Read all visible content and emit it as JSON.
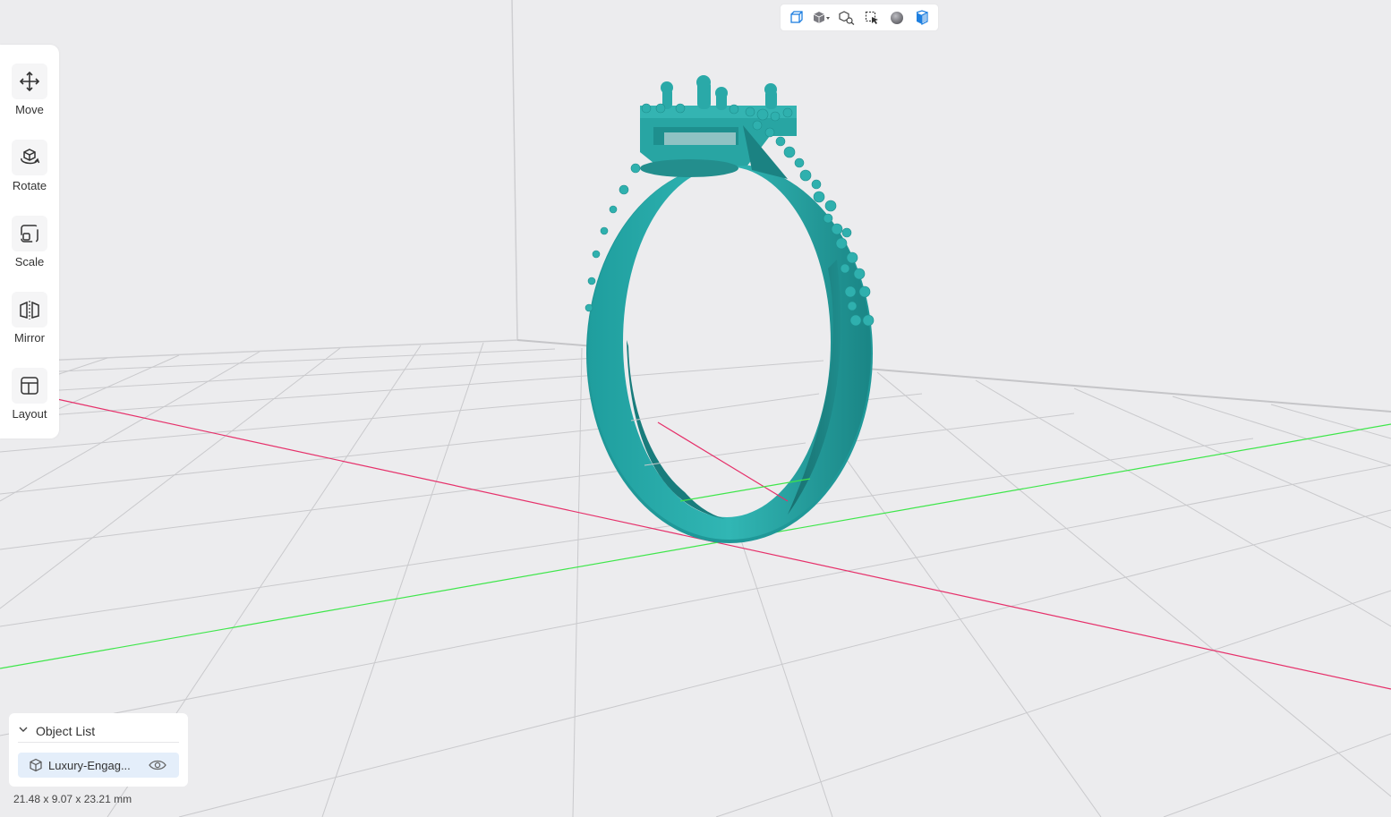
{
  "view_toolbar": {
    "buttons": [
      {
        "name": "perspective-view-icon"
      },
      {
        "name": "standard-views-icon"
      },
      {
        "name": "zoom-fit-icon"
      },
      {
        "name": "select-mode-icon"
      },
      {
        "name": "shading-mode-icon"
      },
      {
        "name": "xray-view-icon"
      }
    ]
  },
  "tools": {
    "move": "Move",
    "rotate": "Rotate",
    "scale": "Scale",
    "mirror": "Mirror",
    "layout": "Layout"
  },
  "object_list": {
    "title": "Object List",
    "items": [
      {
        "name": "Luxury-Engag..."
      }
    ]
  },
  "dimensions": "21.48 x 9.07 x 23.21 mm",
  "colors": {
    "model": "#2aa5a5",
    "x_axis": "#e6306a",
    "y_axis": "#3ee64a",
    "grid": "#c9c9cc",
    "background": "#ececee",
    "accent": "#1e7fe0"
  }
}
